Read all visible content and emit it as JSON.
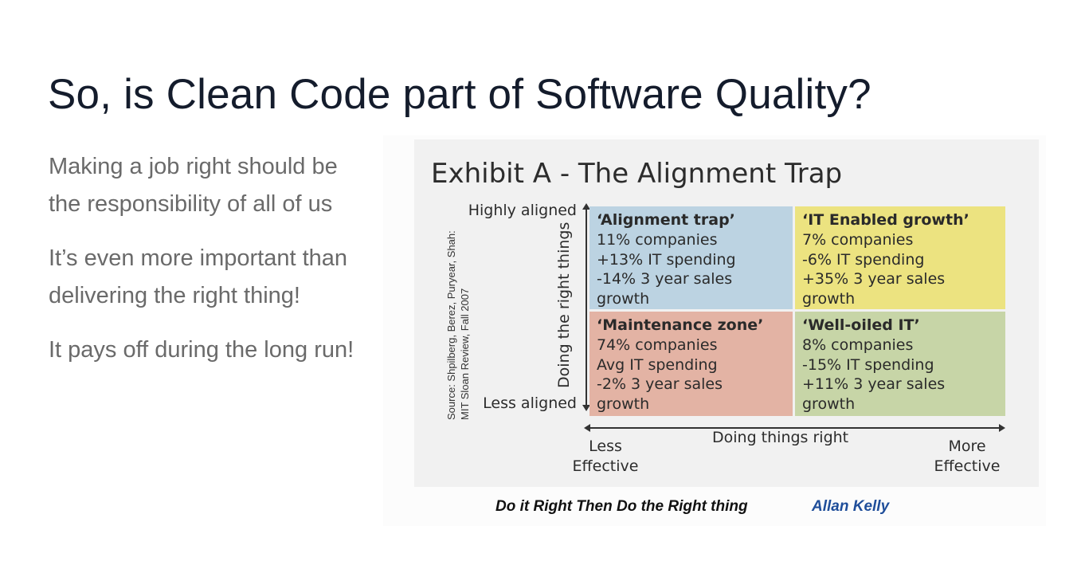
{
  "slide": {
    "title": "So, is Clean Code part of Software Quality?",
    "bullets": [
      "Making a job right should be the responsibility of all of us",
      "It’s even more important than delivering the right thing!",
      "It pays off during the long run!"
    ]
  },
  "exhibit": {
    "title": "Exhibit A - The Alignment Trap",
    "source_line1": "Source: Shpilberg, Berez, Puryear, Shah:",
    "source_line2": "MIT Sloan Review, Fall 2007",
    "y_axis_label": "Doing the right things",
    "y_top_label": "Highly aligned",
    "y_bottom_label": "Less aligned",
    "x_axis_label": "Doing things right",
    "x_left_line1": "Less",
    "x_left_line2": "Effective",
    "x_right_line1": "More",
    "x_right_line2": "Effective",
    "quadrants": [
      {
        "title": "‘Alignment trap’",
        "lines": [
          "11% companies",
          "+13% IT spending",
          "-14% 3 year sales",
          "growth"
        ],
        "color": "#bcd3e2"
      },
      {
        "title": "‘IT Enabled growth’",
        "lines": [
          "7% companies",
          "-6% IT spending",
          "+35% 3 year sales",
          "growth"
        ],
        "color": "#ece380"
      },
      {
        "title": "‘Maintenance zone’",
        "lines": [
          "74% companies",
          "Avg IT spending",
          "-2% 3 year sales",
          "growth"
        ],
        "color": "#e3b3a4"
      },
      {
        "title": "‘Well-oiled IT’",
        "lines": [
          "8% companies",
          "-15% IT spending",
          "+11% 3 year sales",
          "growth"
        ],
        "color": "#c7d5a7"
      }
    ]
  },
  "caption": {
    "text": "Do it Right Then Do the Right thing",
    "author": "Allan Kelly",
    "author_color": "#1f4e9a"
  }
}
